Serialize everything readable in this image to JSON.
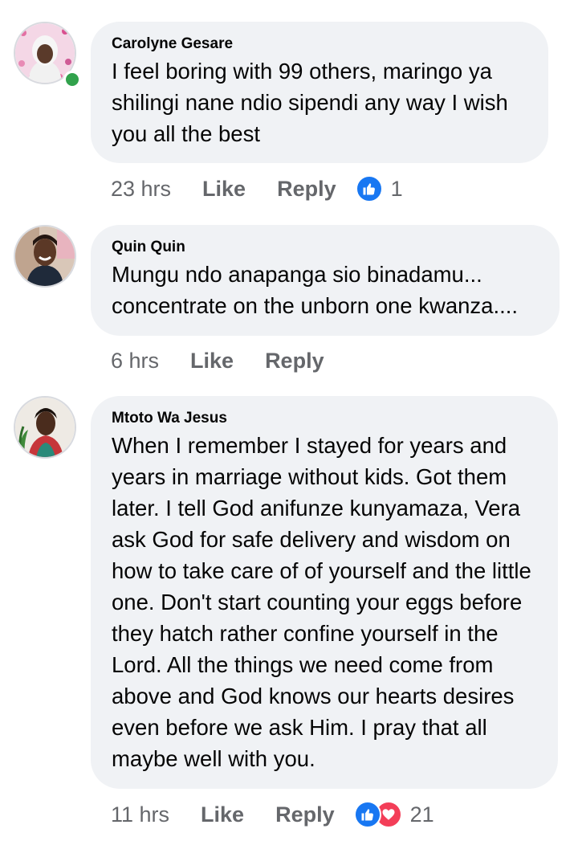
{
  "colors": {
    "bubble": "#f0f2f5",
    "meta_text": "#65676b",
    "like_blue": "#1877f2",
    "love_red": "#f33e58",
    "online_green": "#31a24c"
  },
  "comments": [
    {
      "author": "Carolyne Gesare",
      "text": "I feel boring with 99 others, maringo ya shilingi nane ndio sipendi any way I wish you all the best",
      "time": "23 hrs",
      "like_label": "Like",
      "reply_label": "Reply",
      "reactions": [
        "like-icon"
      ],
      "reaction_count": "1",
      "online": true
    },
    {
      "author": "Quin Quin",
      "text": "Mungu ndo anapanga sio binadamu... concentrate on the unborn one kwanza....",
      "time": "6 hrs",
      "like_label": "Like",
      "reply_label": "Reply",
      "reactions": [],
      "reaction_count": "",
      "online": false
    },
    {
      "author": "Mtoto Wa Jesus",
      "text": "When I remember I stayed for years and years in marriage without kids. Got them later. I tell God anifunze kunyamaza, Vera ask God for safe delivery and wisdom on how to take care of of yourself and the little one. Don't start counting your eggs before they hatch rather confine yourself in the Lord. All the things we need come from above and God knows our hearts desires even before we ask Him. I pray that all maybe well with you.",
      "time": "11 hrs",
      "like_label": "Like",
      "reply_label": "Reply",
      "reactions": [
        "like-icon",
        "love-icon"
      ],
      "reaction_count": "21",
      "online": false
    }
  ]
}
